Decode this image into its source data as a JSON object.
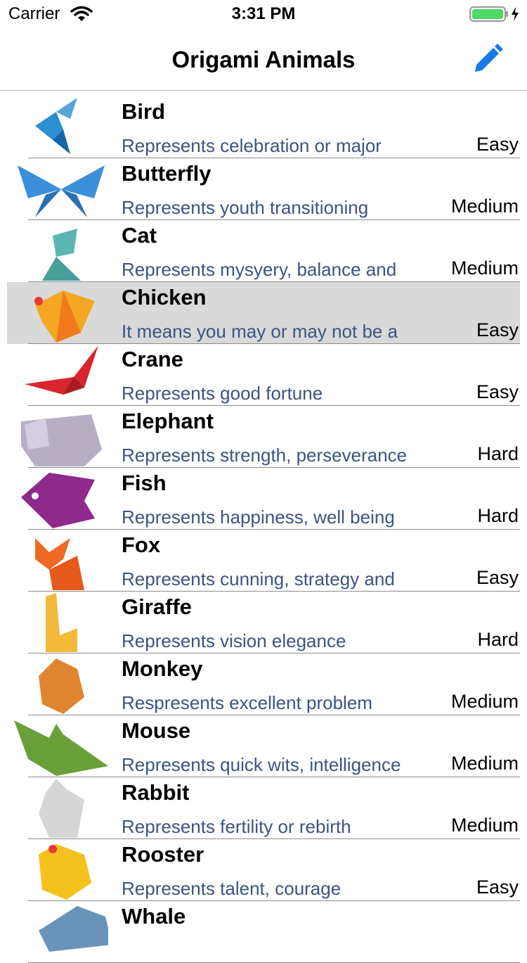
{
  "status_bar": {
    "carrier": "Carrier",
    "time": "3:31 PM"
  },
  "nav": {
    "title": "Origami Animals",
    "edit_icon": "pencil-icon"
  },
  "colors": {
    "accent": "#1a7ae5",
    "description": "#3b5482",
    "selected_row": "#d9d9d9",
    "battery": "#4cd964"
  },
  "animals": [
    {
      "name": "Bird",
      "description": "Represents celebration or major",
      "difficulty": "Easy",
      "icon": "origami-bird",
      "color": "#2a8fd0"
    },
    {
      "name": "Butterfly",
      "description": "Represents youth transitioning",
      "difficulty": "Medium",
      "icon": "origami-butterfly",
      "color": "#3a8fd8"
    },
    {
      "name": "Cat",
      "description": "Represents mysyery, balance and",
      "difficulty": "Medium",
      "icon": "origami-cat",
      "color": "#5bb5b0"
    },
    {
      "name": "Chicken",
      "description": "It means you may or may not be a",
      "difficulty": "Easy",
      "icon": "origami-chicken",
      "color": "#f5a623"
    },
    {
      "name": "Crane",
      "description": "Represents good fortune",
      "difficulty": "Easy",
      "icon": "origami-crane",
      "color": "#d9262e"
    },
    {
      "name": "Elephant",
      "description": "Represents strength, perseverance",
      "difficulty": "Hard",
      "icon": "origami-elephant",
      "color": "#b7aec4"
    },
    {
      "name": "Fish",
      "description": "Represents happiness, well being",
      "difficulty": "Hard",
      "icon": "origami-fish",
      "color": "#8e2a8c"
    },
    {
      "name": "Fox",
      "description": "Represents cunning, strategy and",
      "difficulty": "Easy",
      "icon": "origami-fox",
      "color": "#f06a25"
    },
    {
      "name": "Giraffe",
      "description": "Represents vision elegance",
      "difficulty": "Hard",
      "icon": "origami-giraffe",
      "color": "#f2b93b"
    },
    {
      "name": "Monkey",
      "description": "Respresents excellent problem",
      "difficulty": "Medium",
      "icon": "origami-monkey",
      "color": "#e0852f"
    },
    {
      "name": "Mouse",
      "description": "Represents quick wits, intelligence",
      "difficulty": "Medium",
      "icon": "origami-mouse",
      "color": "#6aa03a"
    },
    {
      "name": "Rabbit",
      "description": "Represents fertility or rebirth",
      "difficulty": "Medium",
      "icon": "origami-rabbit",
      "color": "#d6d6d6"
    },
    {
      "name": "Rooster",
      "description": "Represents talent, courage",
      "difficulty": "Easy",
      "icon": "origami-rooster",
      "color": "#f4c21f"
    },
    {
      "name": "Whale",
      "description": "",
      "difficulty": "",
      "icon": "origami-whale",
      "color": "#6a93b8"
    }
  ],
  "selected_index": 3
}
